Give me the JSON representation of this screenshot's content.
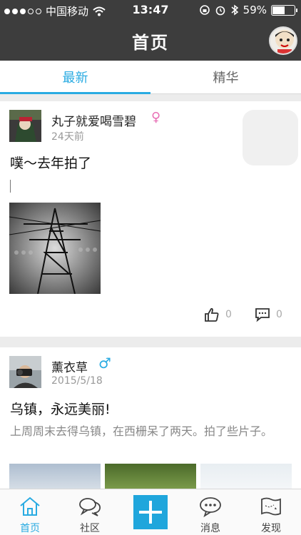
{
  "status_bar": {
    "carrier": "中国移动",
    "time": "13:47",
    "battery": "59%",
    "battery_level": 0.59
  },
  "header": {
    "title": "首页"
  },
  "tabs": [
    {
      "label": "最新",
      "active": true
    },
    {
      "label": "精华",
      "active": false
    }
  ],
  "posts": [
    {
      "username": "丸子就爱喝雪碧",
      "gender": "female",
      "gender_symbol": "♀",
      "date": "24天前",
      "title": "噗～去年拍了",
      "body": "",
      "likes": "0",
      "comments": "0"
    },
    {
      "username": "薰衣草",
      "gender": "male",
      "gender_symbol": "♂",
      "date": "2015/5/18",
      "title": "乌镇，永远美丽!",
      "body": "上周周末去得乌镇，在西栅呆了两天。拍了些片子。"
    }
  ],
  "bottom_nav": [
    {
      "label": "首页",
      "icon": "home-icon",
      "active": true
    },
    {
      "label": "社区",
      "icon": "chat-bubbles-icon",
      "active": false
    },
    {
      "label": "",
      "icon": "plus-icon",
      "active": false
    },
    {
      "label": "消息",
      "icon": "message-icon",
      "active": false
    },
    {
      "label": "发现",
      "icon": "map-icon",
      "active": false
    }
  ],
  "colors": {
    "accent": "#29abe2",
    "header_bg": "#3d3d3d",
    "female": "#e86fb5",
    "male": "#29abe2"
  }
}
